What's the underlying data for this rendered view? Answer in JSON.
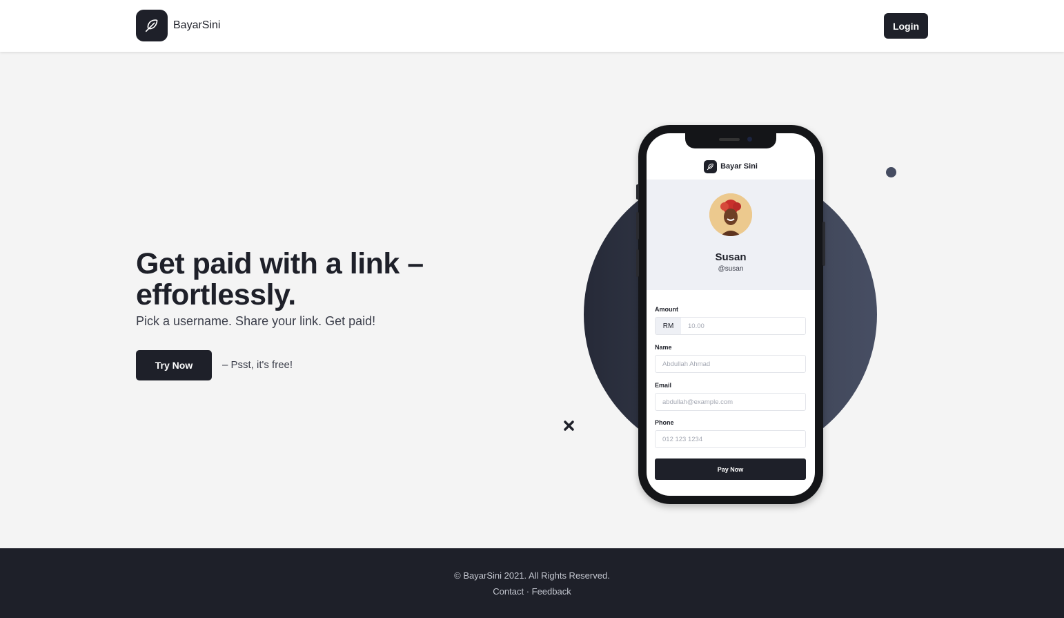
{
  "header": {
    "brand": "BayarSini",
    "login_label": "Login",
    "logo_icon": "feather-icon"
  },
  "hero": {
    "title_line1": "Get paid with a link –",
    "title_line2": "effortlessly.",
    "subtitle": "Pick a username. Share your link. Get paid!",
    "cta_label": "Try Now",
    "cta_note": "– Psst, it's free!"
  },
  "phone": {
    "app_brand": "Bayar Sini",
    "profile": {
      "name": "Susan",
      "handle": "@susan"
    },
    "form": {
      "amount_label": "Amount",
      "currency": "RM",
      "amount_placeholder": "10.00",
      "name_label": "Name",
      "name_placeholder": "Abdullah Ahmad",
      "email_label": "Email",
      "email_placeholder": "abdullah@example.com",
      "phone_label": "Phone",
      "phone_placeholder": "012 123 1234",
      "pay_label": "Pay Now"
    }
  },
  "footer": {
    "copyright": "© BayarSini 2021. All Rights Reserved.",
    "contact": "Contact",
    "separator": " · ",
    "feedback": "Feedback"
  },
  "colors": {
    "primary": "#1e2029",
    "background": "#f4f4f4",
    "accent_circle": "#3a4050",
    "profile_bg": "#eef0f5"
  }
}
